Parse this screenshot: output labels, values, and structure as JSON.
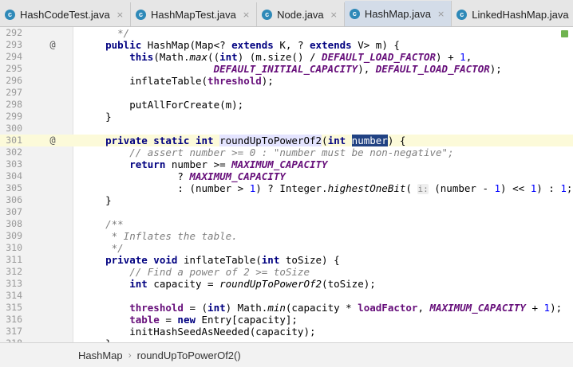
{
  "tabs": [
    {
      "label": "HashCodeTest.java",
      "icon": "c",
      "active": false
    },
    {
      "label": "HashMapTest.java",
      "icon": "c",
      "active": false
    },
    {
      "label": "Node.java",
      "icon": "c",
      "active": false
    },
    {
      "label": "HashMap.java",
      "icon": "c",
      "active": true
    },
    {
      "label": "LinkedHashMap.java",
      "icon": "c",
      "active": false
    }
  ],
  "editor": {
    "lines": [
      {
        "n": "292",
        "tokens": [
          [
            "cm",
            "      */"
          ]
        ]
      },
      {
        "n": "293",
        "mark": "@",
        "tokens": [
          [
            "kw",
            "    public "
          ],
          [
            "pl",
            "HashMap(Map<? "
          ],
          [
            "kw",
            "extends "
          ],
          [
            "pl",
            "K, ? "
          ],
          [
            "kw",
            "extends "
          ],
          [
            "pl",
            "V> m) {"
          ]
        ]
      },
      {
        "n": "294",
        "tokens": [
          [
            "kw",
            "        this"
          ],
          [
            "pl",
            "(Math."
          ],
          [
            "sm",
            "max"
          ],
          [
            "pl",
            "(("
          ],
          [
            "kw",
            "int"
          ],
          [
            "pl",
            ") (m.size() / "
          ],
          [
            "co",
            "DEFAULT_LOAD_FACTOR"
          ],
          [
            "pl",
            ") + "
          ],
          [
            "nu",
            "1"
          ],
          [
            "pl",
            ","
          ]
        ]
      },
      {
        "n": "295",
        "tokens": [
          [
            "co",
            "                      DEFAULT_INITIAL_CAPACITY"
          ],
          [
            "pl",
            "), "
          ],
          [
            "co",
            "DEFAULT_LOAD_FACTOR"
          ],
          [
            "pl",
            ");"
          ]
        ]
      },
      {
        "n": "296",
        "tokens": [
          [
            "pl",
            "        inflateTable("
          ],
          [
            "fi",
            "threshold"
          ],
          [
            "pl",
            ");"
          ]
        ]
      },
      {
        "n": "297",
        "tokens": []
      },
      {
        "n": "298",
        "tokens": [
          [
            "pl",
            "        putAllForCreate(m);"
          ]
        ]
      },
      {
        "n": "299",
        "tokens": [
          [
            "pl",
            "    }"
          ]
        ]
      },
      {
        "n": "300",
        "tokens": []
      },
      {
        "n": "301",
        "mark": "@",
        "current": true,
        "tokens": [
          [
            "kw",
            "    private static int "
          ],
          [
            "ca",
            "roundUpToPowerOf2"
          ],
          [
            "pl",
            "("
          ],
          [
            "kw",
            "int "
          ],
          [
            "se",
            "number"
          ],
          [
            "pl",
            ") {"
          ]
        ]
      },
      {
        "n": "302",
        "tokens": [
          [
            "cm",
            "        // assert number >= 0 : \"number must be non-negative\";"
          ]
        ]
      },
      {
        "n": "303",
        "tokens": [
          [
            "kw",
            "        return "
          ],
          [
            "pl",
            "number >= "
          ],
          [
            "co",
            "MAXIMUM_CAPACITY"
          ]
        ]
      },
      {
        "n": "304",
        "tokens": [
          [
            "pl",
            "                ? "
          ],
          [
            "co",
            "MAXIMUM_CAPACITY"
          ]
        ]
      },
      {
        "n": "305",
        "tokens": [
          [
            "pl",
            "                : (number > "
          ],
          [
            "nu",
            "1"
          ],
          [
            "pl",
            ") ? Integer."
          ],
          [
            "sm",
            "highestOneBit"
          ],
          [
            "pl",
            "( "
          ],
          [
            "hi",
            "i:"
          ],
          [
            "pl",
            " (number - "
          ],
          [
            "nu",
            "1"
          ],
          [
            "pl",
            ") << "
          ],
          [
            "nu",
            "1"
          ],
          [
            "pl",
            ") : "
          ],
          [
            "nu",
            "1"
          ],
          [
            "pl",
            ";"
          ]
        ]
      },
      {
        "n": "306",
        "tokens": [
          [
            "pl",
            "    }"
          ]
        ]
      },
      {
        "n": "307",
        "tokens": []
      },
      {
        "n": "308",
        "tokens": [
          [
            "cm",
            "    /**"
          ]
        ]
      },
      {
        "n": "309",
        "tokens": [
          [
            "cm",
            "     * Inflates the table."
          ]
        ]
      },
      {
        "n": "310",
        "tokens": [
          [
            "cm",
            "     */"
          ]
        ]
      },
      {
        "n": "311",
        "tokens": [
          [
            "kw",
            "    private void "
          ],
          [
            "pl",
            "inflateTable("
          ],
          [
            "kw",
            "int "
          ],
          [
            "pl",
            "toSize) {"
          ]
        ]
      },
      {
        "n": "312",
        "tokens": [
          [
            "cm",
            "        // Find a power of 2 >= toSize"
          ]
        ]
      },
      {
        "n": "313",
        "tokens": [
          [
            "kw",
            "        int "
          ],
          [
            "pl",
            "capacity = "
          ],
          [
            "sm",
            "roundUpToPowerOf2"
          ],
          [
            "pl",
            "(toSize);"
          ]
        ]
      },
      {
        "n": "314",
        "tokens": []
      },
      {
        "n": "315",
        "tokens": [
          [
            "fi",
            "        threshold "
          ],
          [
            "pl",
            "= ("
          ],
          [
            "kw",
            "int"
          ],
          [
            "pl",
            ") Math."
          ],
          [
            "sm",
            "min"
          ],
          [
            "pl",
            "(capacity * "
          ],
          [
            "fi",
            "loadFactor"
          ],
          [
            "pl",
            ", "
          ],
          [
            "co",
            "MAXIMUM_CAPACITY "
          ],
          [
            "pl",
            "+ "
          ],
          [
            "nu",
            "1"
          ],
          [
            "pl",
            ");"
          ]
        ]
      },
      {
        "n": "316",
        "tokens": [
          [
            "fi",
            "        table "
          ],
          [
            "pl",
            "= "
          ],
          [
            "kw",
            "new "
          ],
          [
            "pl",
            "Entry[capacity];"
          ]
        ]
      },
      {
        "n": "317",
        "tokens": [
          [
            "pl",
            "        initHashSeedAsNeeded(capacity);"
          ]
        ]
      },
      {
        "n": "318",
        "tokens": [
          [
            "pl",
            "    }"
          ]
        ]
      }
    ]
  },
  "breadcrumb": {
    "class": "HashMap",
    "method": "roundUpToPowerOf2()"
  }
}
